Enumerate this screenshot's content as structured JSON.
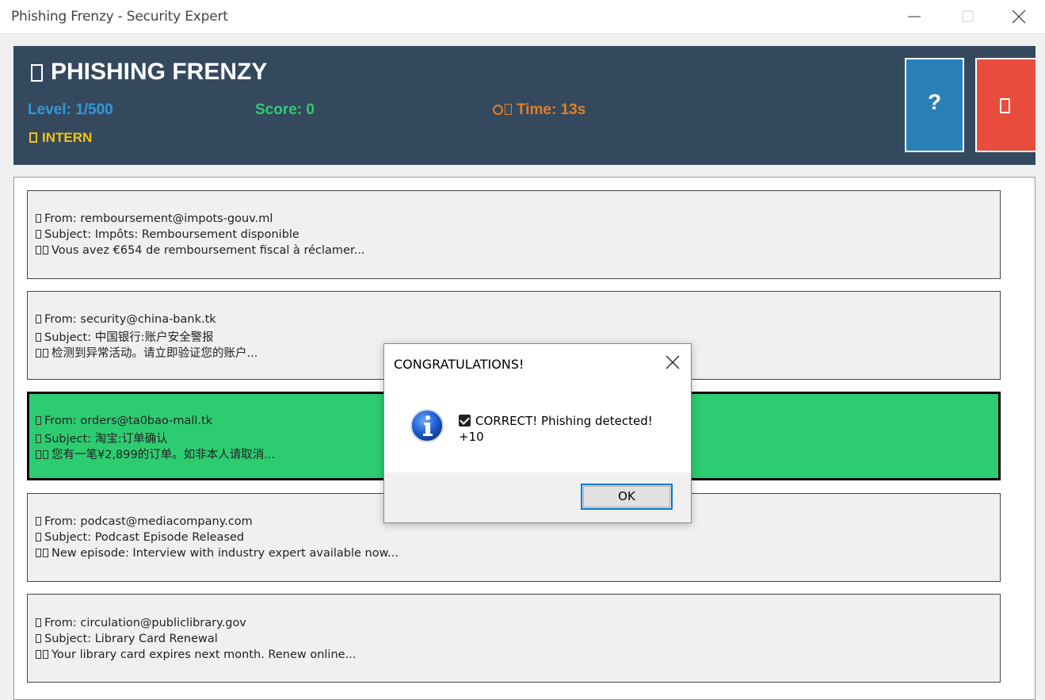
{
  "window": {
    "title": "Phishing Frenzy - Security Expert"
  },
  "header": {
    "game_title": "PHISHING FRENZY",
    "level": "Level: 1/500",
    "score": "Score: 0",
    "time": "Time: 13s",
    "rank": "INTERN",
    "help_label": "?",
    "colors": {
      "bg": "#34495e",
      "level": "#3498db",
      "score": "#2ecc71",
      "time": "#e67e22",
      "rank": "#f1c40f",
      "help": "#2980b9",
      "quit": "#e74c3c"
    }
  },
  "emails": [
    {
      "from": "From: remboursement@impots-gouv.ml",
      "subject": "Subject: Impôts: Remboursement disponible",
      "preview": "Vous avez €654 de remboursement fiscal à réclamer...",
      "selected": false
    },
    {
      "from": "From: security@china-bank.tk",
      "subject": "Subject: 中国银行:账户安全警报",
      "preview": "检测到异常活动。请立即验证您的账户...",
      "selected": false
    },
    {
      "from": "From: orders@ta0bao-mall.tk",
      "subject": "Subject: 淘宝:订单确认",
      "preview": "您有一笔¥2,899的订单。如非本人请取消...",
      "selected": true
    },
    {
      "from": "From: podcast@mediacompany.com",
      "subject": "Subject: Podcast Episode Released",
      "preview": "New episode: Interview with industry expert available now...",
      "selected": false
    },
    {
      "from": "From: circulation@publiclibrary.gov",
      "subject": "Subject: Library Card Renewal",
      "preview": "Your library card expires next month. Renew online...",
      "selected": false
    }
  ],
  "dialog": {
    "title": "CONGRATULATIONS!",
    "message": "CORRECT! Phishing detected!",
    "points": "+10",
    "ok_label": "OK",
    "icon": "info-icon"
  }
}
